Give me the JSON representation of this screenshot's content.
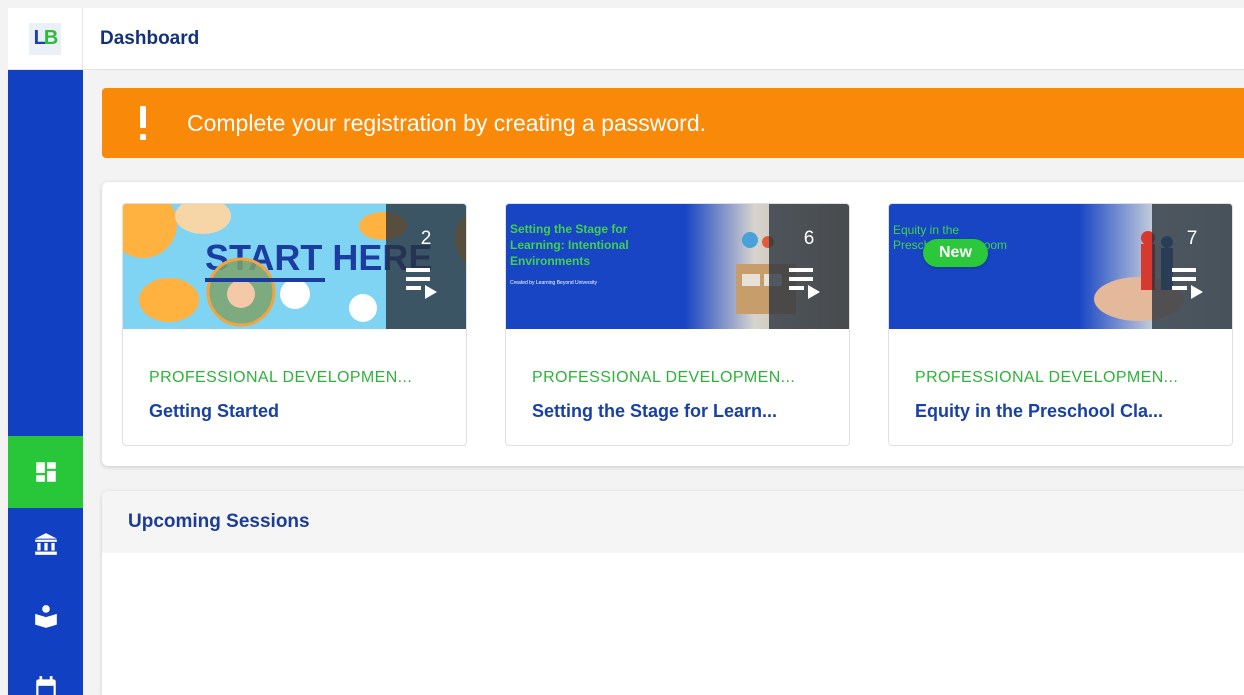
{
  "header": {
    "logo_letters": [
      "L",
      "B"
    ],
    "title": "Dashboard"
  },
  "sidebar": {
    "items": [
      {
        "icon": "dashboard-icon",
        "active": true
      },
      {
        "icon": "institution-icon",
        "active": false
      },
      {
        "icon": "reader-icon",
        "active": false
      },
      {
        "icon": "calendar-icon",
        "active": false
      }
    ]
  },
  "alert": {
    "message": "Complete your registration by creating a password."
  },
  "courses": [
    {
      "thumb_text": "START HERE",
      "count": "2",
      "category": "PROFESSIONAL DEVELOPMEN...",
      "title": "Getting Started",
      "is_new": false
    },
    {
      "thumb_text": "Setting the Stage for Learning: Intentional Environments",
      "thumb_caption": "Created by Learning Beyond University",
      "count": "6",
      "category": "PROFESSIONAL DEVELOPMEN...",
      "title": "Setting the Stage for Learn...",
      "is_new": false
    },
    {
      "thumb_text": "Equity in the Preschool Classroom",
      "count": "7",
      "category": "PROFESSIONAL DEVELOPMEN...",
      "title": "Equity in the Preschool Cla...",
      "is_new": true,
      "badge": "New"
    }
  ],
  "sessions": {
    "title": "Upcoming Sessions"
  },
  "colors": {
    "sidebar": "#1140c2",
    "active_nav": "#28c639",
    "alert": "#f98a09",
    "title_blue": "#1840a6",
    "category_green": "#2fb23a"
  }
}
